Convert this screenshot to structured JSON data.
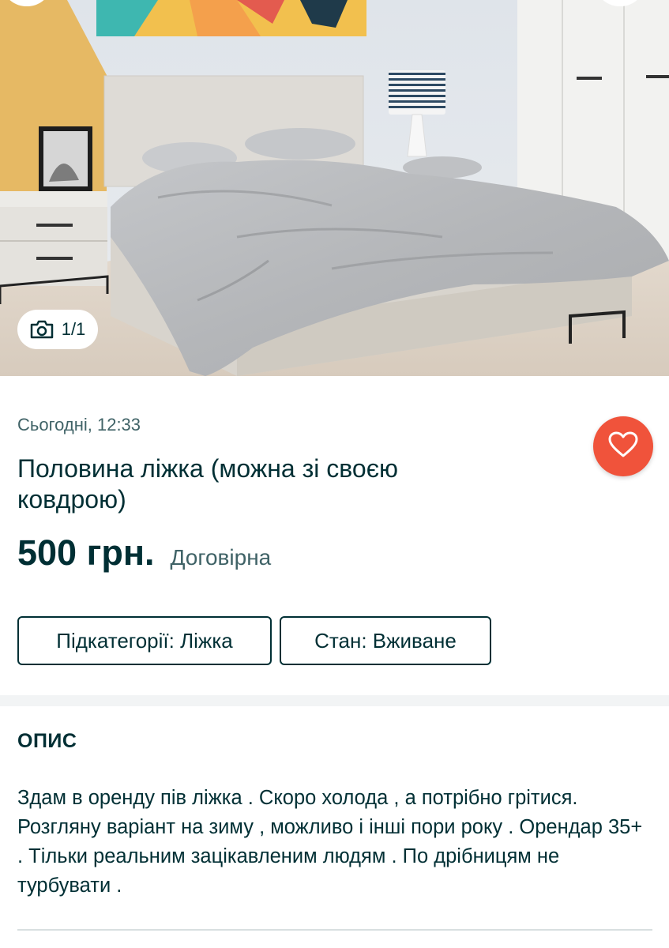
{
  "gallery": {
    "counter": "1/1",
    "counter_icon": "camera-icon"
  },
  "listing": {
    "date": "Сьогодні, 12:33",
    "title": "Половина ліжка (можна зі своєю ковдрою)",
    "price": "500 грн.",
    "price_note": "Договірна",
    "favorite_icon": "heart-icon",
    "tags": [
      {
        "label": "Підкатегорії: Ліжка"
      },
      {
        "label": "Стан: Вживане"
      }
    ]
  },
  "description": {
    "heading": "ОПИС",
    "text": "Здам в оренду пів ліжка . Скоро холода , а потрібно грітися. Розгляну варіант на зиму , можливо і інші пори року . Орендар 35+ . Тільки реальним зацікавленим людям . По дрібницям не турбувати ."
  },
  "colors": {
    "text_primary": "#002f34",
    "text_secondary": "#406367",
    "favorite_bg": "#f0533b",
    "divider_band": "#f2f4f5"
  }
}
